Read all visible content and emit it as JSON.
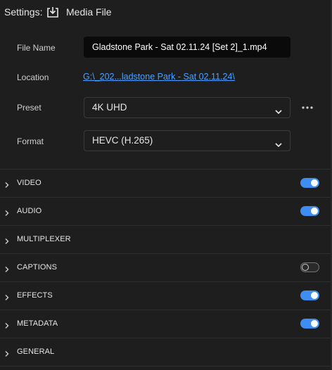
{
  "header": {
    "settings_label": "Settings:",
    "title": "Media File",
    "icon": "export-icon"
  },
  "fields": {
    "file_name": {
      "label": "File Name",
      "value": "Gladstone Park - Sat 02.11.24 [Set 2]_1.mp4"
    },
    "location": {
      "label": "Location",
      "value": "G:\\_202...ladstone Park - Sat 02.11.24\\"
    },
    "preset": {
      "label": "Preset",
      "value": "4K UHD"
    },
    "format": {
      "label": "Format",
      "value": "HEVC (H.265)"
    }
  },
  "sections": [
    {
      "label": "VIDEO",
      "toggle": "on"
    },
    {
      "label": "AUDIO",
      "toggle": "on"
    },
    {
      "label": "MULTIPLEXER",
      "toggle": "none"
    },
    {
      "label": "CAPTIONS",
      "toggle": "off"
    },
    {
      "label": "EFFECTS",
      "toggle": "on"
    },
    {
      "label": "METADATA",
      "toggle": "on"
    },
    {
      "label": "GENERAL",
      "toggle": "none"
    }
  ],
  "colors": {
    "background": "#1e1e1e",
    "accent": "#3d8ef0",
    "link": "#4aa0ff"
  }
}
